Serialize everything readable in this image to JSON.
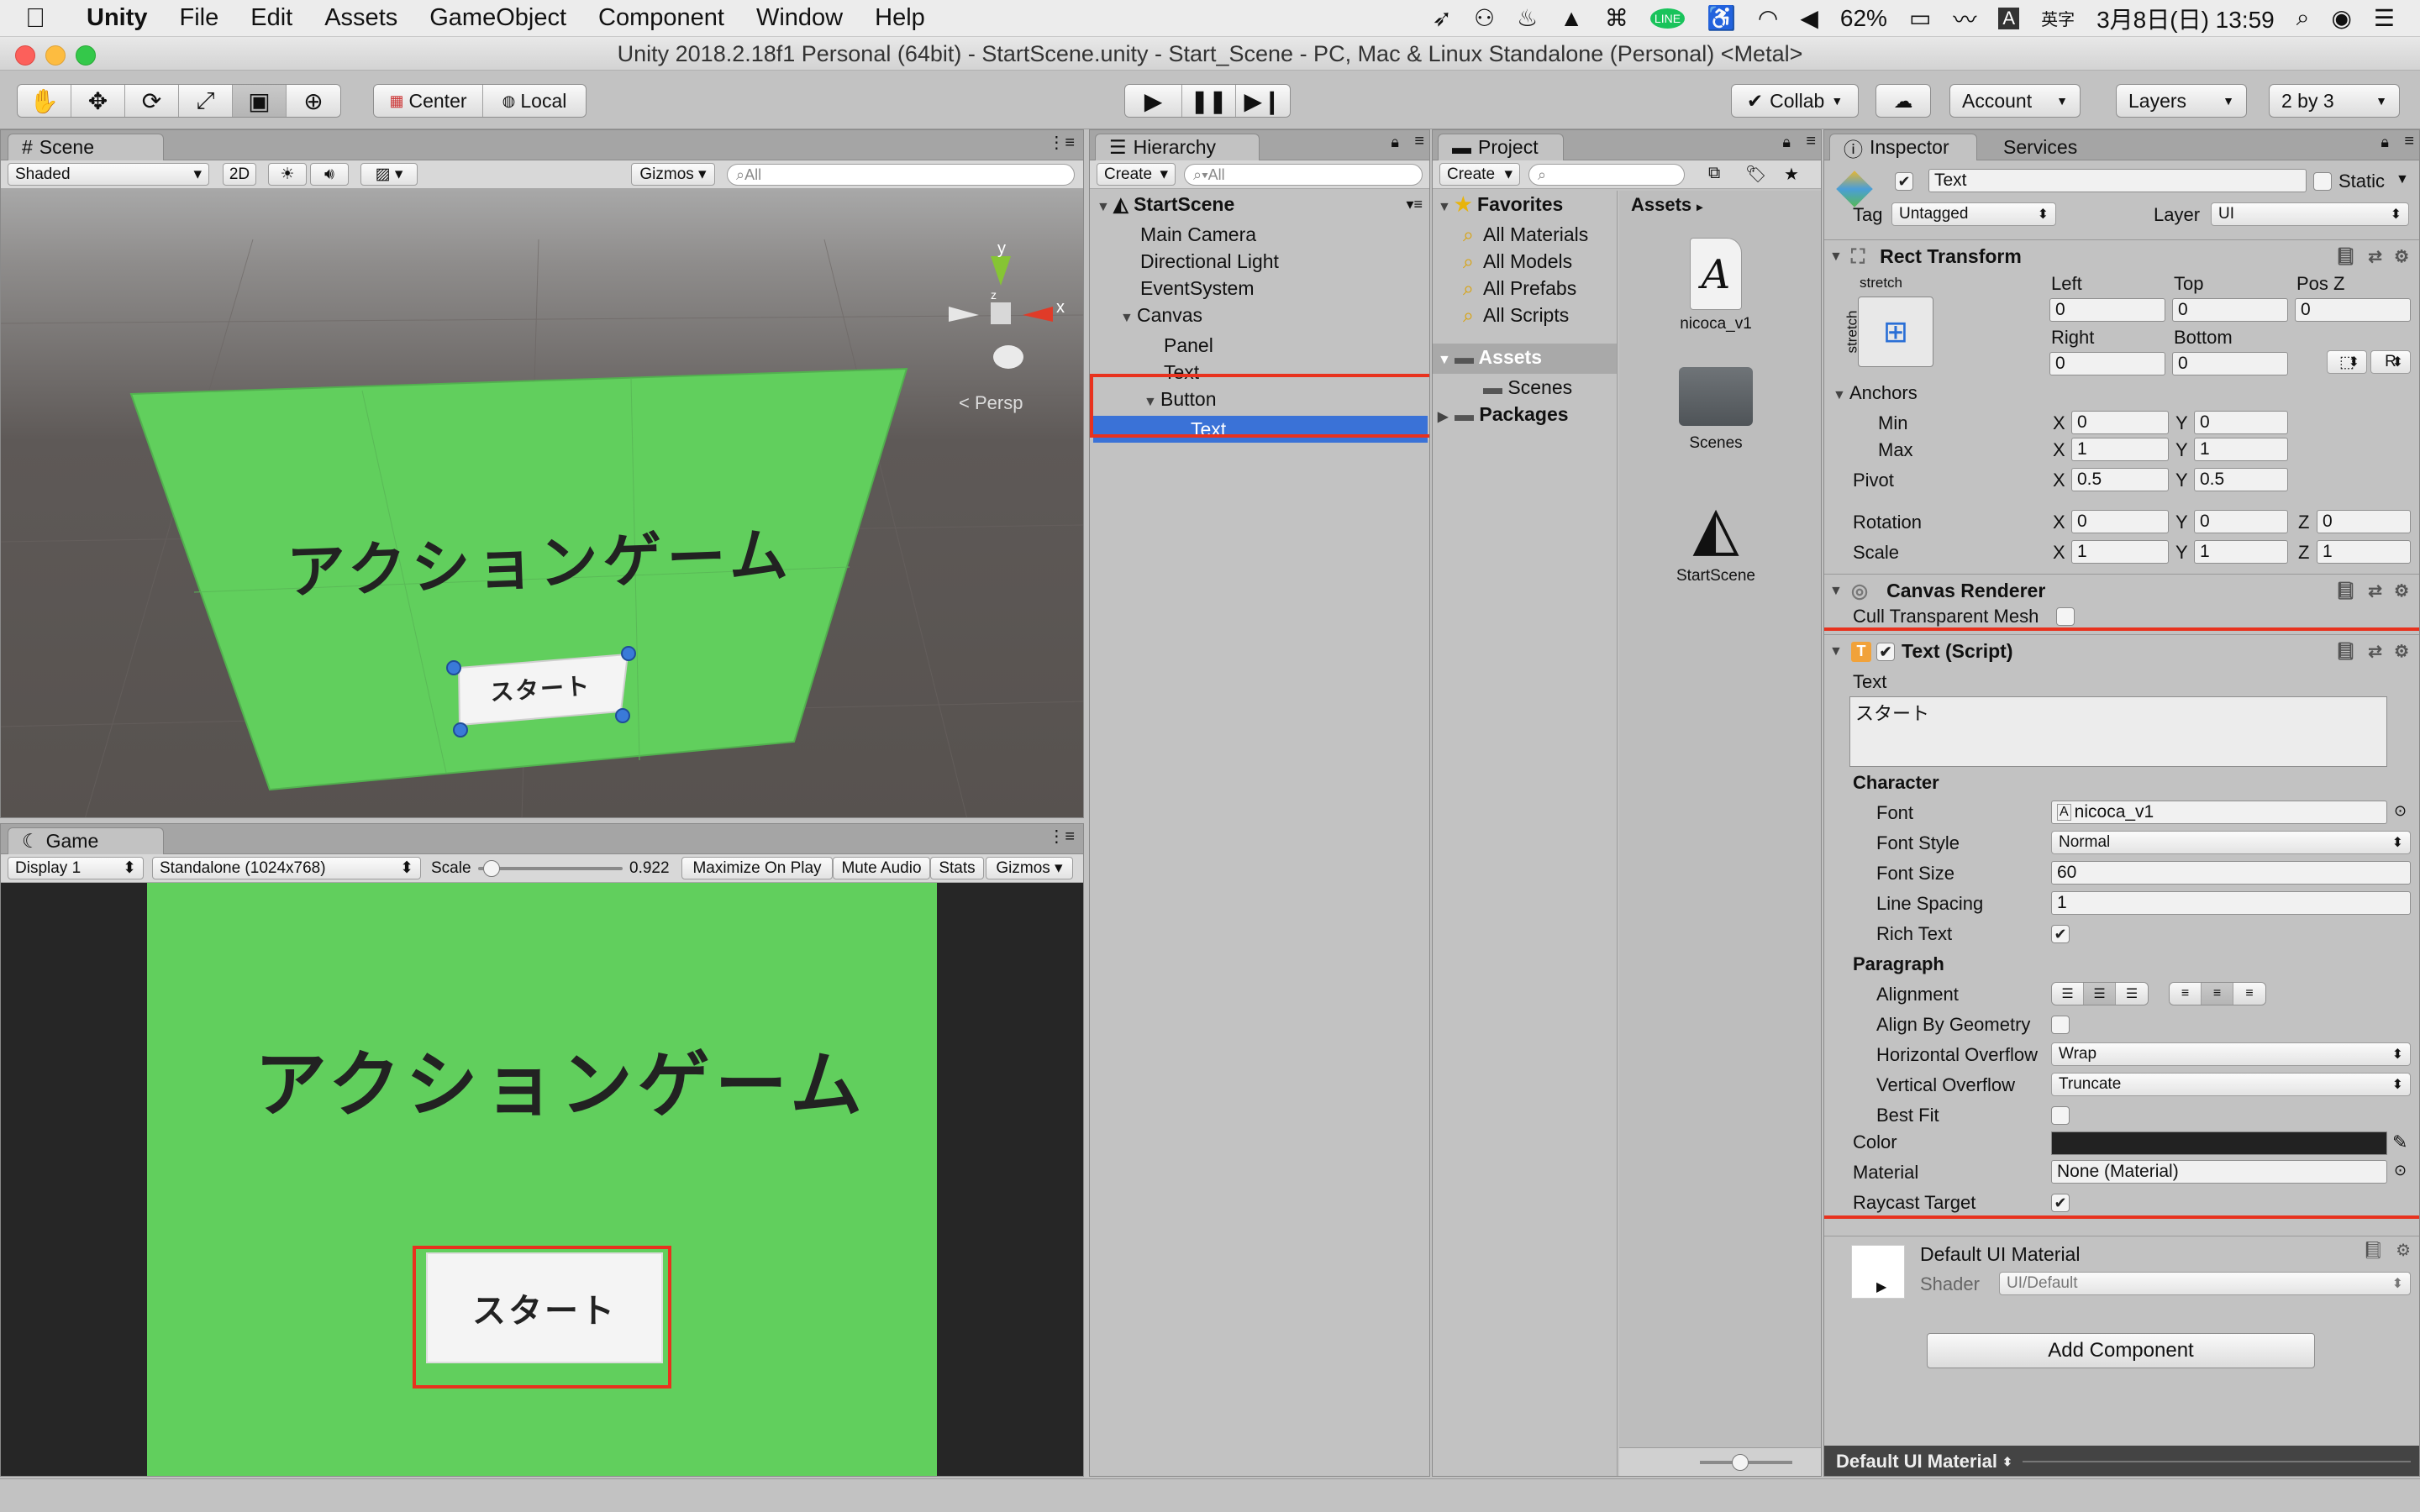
{
  "menubar": {
    "app": "Unity",
    "items": [
      "File",
      "Edit",
      "Assets",
      "GameObject",
      "Component",
      "Window",
      "Help"
    ],
    "battery": "62%",
    "ime": "英字",
    "datetime": "3月8日(日) 13:59"
  },
  "window": {
    "title": "Unity 2018.2.18f1 Personal (64bit) - StartScene.unity - Start_Scene - PC, Mac & Linux Standalone (Personal) <Metal>"
  },
  "toolbar": {
    "center": "Center",
    "local": "Local",
    "collab": "Collab",
    "account": "Account",
    "layers": "Layers",
    "layout": "2 by 3"
  },
  "scene": {
    "tab": "Scene",
    "shading": "Shaded",
    "mode2d": "2D",
    "gizmos": "Gizmos",
    "search": "All",
    "persp": "< Persp",
    "axis_y": "y",
    "axis_x": "x",
    "axis_z": "z",
    "title_text": "アクションゲーム",
    "button_text": "スタート"
  },
  "game": {
    "tab": "Game",
    "display": "Display 1",
    "resolution": "Standalone (1024x768)",
    "scale_label": "Scale",
    "scale_value": "0.922",
    "scale_fraction": 0.04,
    "maximize": "Maximize On Play",
    "mute": "Mute Audio",
    "stats": "Stats",
    "gizmos": "Gizmos",
    "title_text": "アクションゲーム",
    "button_text": "スタート"
  },
  "hierarchy": {
    "tab": "Hierarchy",
    "create": "Create",
    "search": "All",
    "scene": "StartScene",
    "items": [
      "Main Camera",
      "Directional Light",
      "EventSystem",
      "Canvas",
      "Panel",
      "Text",
      "Button",
      "Text"
    ]
  },
  "project": {
    "tab": "Project",
    "create": "Create",
    "favorites": "Favorites",
    "fav_items": [
      "All Materials",
      "All Models",
      "All Prefabs",
      "All Scripts"
    ],
    "assets": "Assets",
    "scenes": "Scenes",
    "packages": "Packages",
    "breadcrumb": "Assets",
    "files": [
      "nicoca_v1",
      "Scenes",
      "StartScene"
    ]
  },
  "inspector": {
    "tab": "Inspector",
    "services": "Services",
    "name": "Text",
    "static": "Static",
    "tag_label": "Tag",
    "tag": "Untagged",
    "layer_label": "Layer",
    "layer": "UI",
    "rect": {
      "title": "Rect Transform",
      "stretch": "stretch",
      "left_l": "Left",
      "top_l": "Top",
      "posz_l": "Pos Z",
      "left": "0",
      "top": "0",
      "posz": "0",
      "right_l": "Right",
      "bottom_l": "Bottom",
      "right": "0",
      "bottom": "0",
      "r_btn": "R",
      "anchors": "Anchors",
      "min": "Min",
      "max": "Max",
      "pivot": "Pivot",
      "rotation": "Rotation",
      "scale": "Scale",
      "x": "X",
      "y": "Y",
      "z": "Z",
      "min_x": "0",
      "min_y": "0",
      "max_x": "1",
      "max_y": "1",
      "pivot_x": "0.5",
      "pivot_y": "0.5",
      "rot_x": "0",
      "rot_y": "0",
      "rot_z": "0",
      "scale_x": "1",
      "scale_y": "1",
      "scale_z": "1"
    },
    "canvas_renderer": {
      "title": "Canvas Renderer",
      "cull": "Cull Transparent Mesh"
    },
    "text_script": {
      "title": "Text (Script)",
      "text_label": "Text",
      "text_value": "スタート",
      "character": "Character",
      "font_l": "Font",
      "font": "nicoca_v1",
      "style_l": "Font Style",
      "style": "Normal",
      "size_l": "Font Size",
      "size": "60",
      "spacing_l": "Line Spacing",
      "spacing": "1",
      "rich_l": "Rich Text",
      "paragraph": "Paragraph",
      "align_l": "Alignment",
      "geom_l": "Align By Geometry",
      "hover_l": "Horizontal Overflow",
      "hover": "Wrap",
      "vover_l": "Vertical Overflow",
      "vover": "Truncate",
      "best_l": "Best Fit",
      "color_l": "Color",
      "material_l": "Material",
      "material": "None (Material)",
      "raycast_l": "Raycast Target"
    },
    "default_material": "Default UI Material",
    "shader_l": "Shader",
    "shader": "UI/Default",
    "add_component": "Add Component",
    "footer": "Default UI Material"
  }
}
